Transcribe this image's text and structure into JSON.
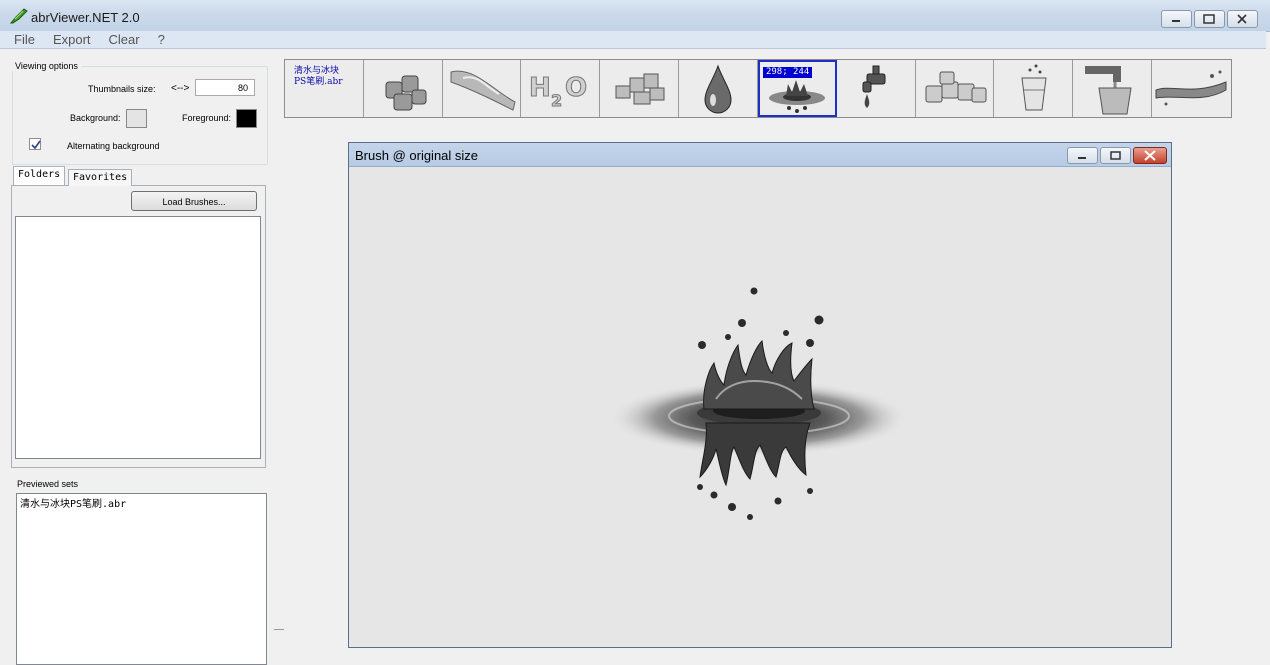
{
  "window": {
    "title": "abrViewer.NET 2.0"
  },
  "menu": {
    "items": [
      "File",
      "Export",
      "Clear",
      "?"
    ]
  },
  "viewing_options": {
    "legend": "Viewing options",
    "thumb_size_label": "Thumbnails size:",
    "thumb_arrows": "<-->",
    "thumb_size_value": "80",
    "background_label": "Background:",
    "background_color": "#e4e4e4",
    "foreground_label": "Foreground:",
    "foreground_color": "#000000",
    "alternating_label": "Alternating background",
    "alternating_checked": true
  },
  "tabs": {
    "folders": "Folders",
    "favorites": "Favorites"
  },
  "folders": {
    "load_button": "Load Brushes..."
  },
  "previewed": {
    "label": "Previewed sets",
    "items": [
      "清水与冰块PS笔刷.abr"
    ]
  },
  "strip": {
    "first_name_line1": "清水与冰块",
    "first_name_line2": "PS笔刷.abr",
    "selected_coord": "298; 244",
    "thumb_icons": [
      "brush-name-cell",
      "ice-cubes-icon",
      "water-wave-icon",
      "h2o-text-icon",
      "ice-pile-icon",
      "water-drop-icon",
      "water-splash-crown-icon",
      "faucet-drip-icon",
      "ice-cubes-row-icon",
      "glass-splash-icon",
      "tap-glass-icon",
      "water-stream-icon"
    ]
  },
  "brush_window": {
    "title": "Brush @ original size"
  }
}
